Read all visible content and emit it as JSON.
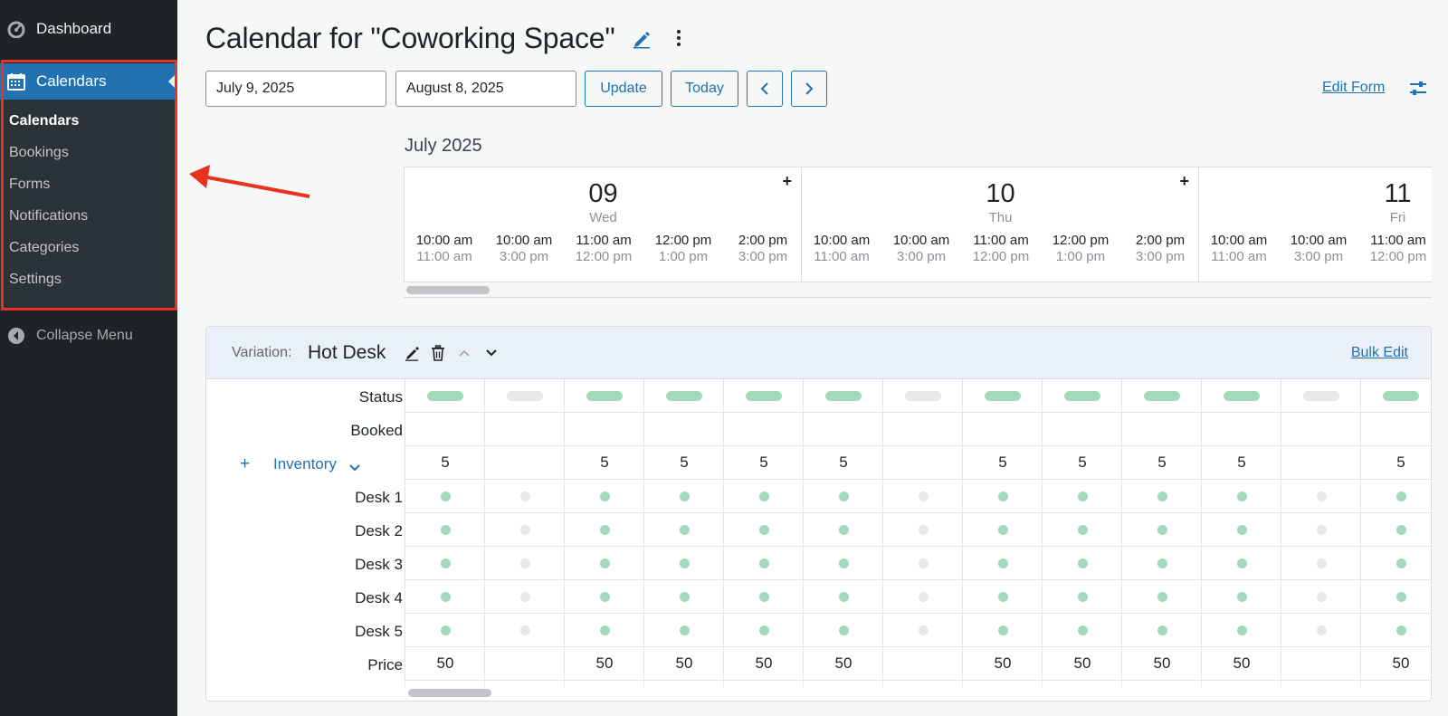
{
  "sidebar": {
    "dashboard_label": "Dashboard",
    "calendars_label": "Calendars",
    "submenu": [
      "Calendars",
      "Bookings",
      "Forms",
      "Notifications",
      "Categories",
      "Settings"
    ],
    "collapse_label": "Collapse Menu"
  },
  "header": {
    "title": "Calendar for \"Coworking Space\"",
    "start_date": "July 9, 2025",
    "end_date": "August 8, 2025",
    "update_label": "Update",
    "today_label": "Today",
    "edit_form_label": "Edit Form"
  },
  "calendar": {
    "month": "July 2025",
    "days": [
      {
        "num": "09",
        "name": "Wed"
      },
      {
        "num": "10",
        "name": "Thu"
      },
      {
        "num": "11",
        "name": "Fri"
      }
    ],
    "slots": [
      {
        "start": "10:00 am",
        "end": "11:00 am"
      },
      {
        "start": "10:00 am",
        "end": "3:00 pm"
      },
      {
        "start": "11:00 am",
        "end": "12:00 pm"
      },
      {
        "start": "12:00 pm",
        "end": "1:00 pm"
      },
      {
        "start": "2:00 pm",
        "end": "3:00 pm"
      },
      {
        "start": "10:00 am",
        "end": "11:00 am"
      },
      {
        "start": "10:00 am",
        "end": "3:00 pm"
      },
      {
        "start": "11:00 am",
        "end": "12:00 pm"
      },
      {
        "start": "12:00 pm",
        "end": "1:00 pm"
      },
      {
        "start": "2:00 pm",
        "end": "3:00 pm"
      },
      {
        "start": "10:00 am",
        "end": "11:00 am"
      },
      {
        "start": "10:00 am",
        "end": "3:00 pm"
      },
      {
        "start": "11:00 am",
        "end": "12:00 pm"
      }
    ]
  },
  "variation": {
    "label": "Variation:",
    "name": "Hot Desk",
    "bulk_edit_label": "Bulk Edit",
    "row_labels": {
      "status": "Status",
      "booked": "Booked",
      "inventory": "Inventory",
      "desks": [
        "Desk 1",
        "Desk 2",
        "Desk 3",
        "Desk 4",
        "Desk 5"
      ],
      "price": "Price"
    },
    "columns": [
      {
        "available": true,
        "inventory": "5",
        "price": "50"
      },
      {
        "available": false,
        "inventory": "",
        "price": ""
      },
      {
        "available": true,
        "inventory": "5",
        "price": "50"
      },
      {
        "available": true,
        "inventory": "5",
        "price": "50"
      },
      {
        "available": true,
        "inventory": "5",
        "price": "50"
      },
      {
        "available": true,
        "inventory": "5",
        "price": "50"
      },
      {
        "available": false,
        "inventory": "",
        "price": ""
      },
      {
        "available": true,
        "inventory": "5",
        "price": "50"
      },
      {
        "available": true,
        "inventory": "5",
        "price": "50"
      },
      {
        "available": true,
        "inventory": "5",
        "price": "50"
      },
      {
        "available": true,
        "inventory": "5",
        "price": "50"
      },
      {
        "available": false,
        "inventory": "",
        "price": ""
      },
      {
        "available": true,
        "inventory": "5",
        "price": "50"
      }
    ]
  },
  "colors": {
    "sidebar_bg": "#1d2327",
    "active_blue": "#2271b1",
    "available_green": "#a3d9bd",
    "unavailable_grey": "#e8e8e8",
    "annotation_red": "#e8321f"
  }
}
